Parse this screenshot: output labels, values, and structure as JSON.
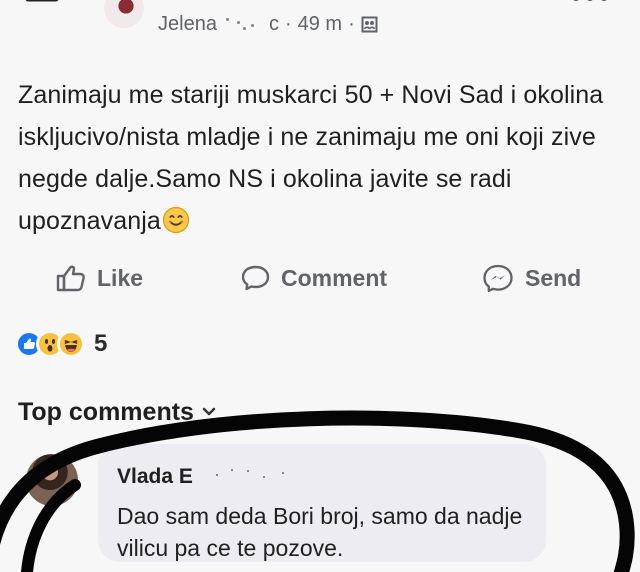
{
  "header": {
    "author": "Jelena",
    "author_suffix": "c",
    "separator": "·",
    "time": "49 m",
    "audience_icon": "friends-icon",
    "back_icon": "back-arrow-icon",
    "more_icon": "more-icon"
  },
  "post": {
    "text": "Zanimaju me stariji muskarci 50 + Novi Sad i okolina iskljucivo/nista mladje i ne zanimaju me oni koji zive negde dalje.Samo NS i okolina javite se radi upoznavanja",
    "emoji_icon": "smiling-face-icon"
  },
  "actions": {
    "like": "Like",
    "comment": "Comment",
    "send": "Send"
  },
  "reactions": {
    "icons": [
      "like-reaction-icon",
      "wow-reaction-icon",
      "haha-reaction-icon"
    ],
    "count": "5"
  },
  "comments": {
    "heading": "Top comments",
    "chevron_icon": "chevron-down-icon",
    "items": [
      {
        "author": "Vlada E",
        "text": "Dao sam deda Bori broj, samo da nadje vilicu pa ce te pozove."
      }
    ]
  },
  "colors": {
    "background": "#f7f7f7",
    "text": "#1f1f1f",
    "muted": "#616368",
    "comment_bubble": "#ececf2",
    "marker": "#050505",
    "like_blue": "#1877f2",
    "reaction_yellow": "#f5c33b"
  }
}
